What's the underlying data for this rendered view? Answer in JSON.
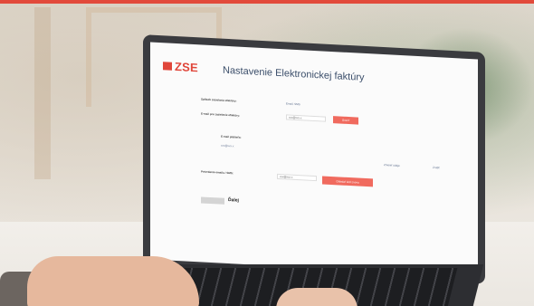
{
  "screen": {
    "logo_text": "ZSE",
    "title": "Nastavenie Elektronickej faktúry",
    "row1": {
      "label": "Spôsob zasielania efaktúry:",
      "value": "Email, SMS"
    },
    "row2": {
      "label": "E-mail pre zasielanie efaktúry:",
      "input_value": "xxx@xxx.x",
      "button_label": "Overiť"
    },
    "section": {
      "label": "E-mail platiteľa:",
      "value": "xxx@xxx.x"
    },
    "links": [
      "Zmeniť údaje",
      "Zrušiť"
    ],
    "row3": {
      "label": "Potvrdenie emailu / SMS:",
      "input_value": "xxx@xxx.x",
      "button_label": "Odoslať kód znova"
    },
    "continue_label": "Ďalej"
  },
  "colors": {
    "brand": "#e0463a",
    "title": "#3c4f6b",
    "button": "#f06a5e"
  }
}
